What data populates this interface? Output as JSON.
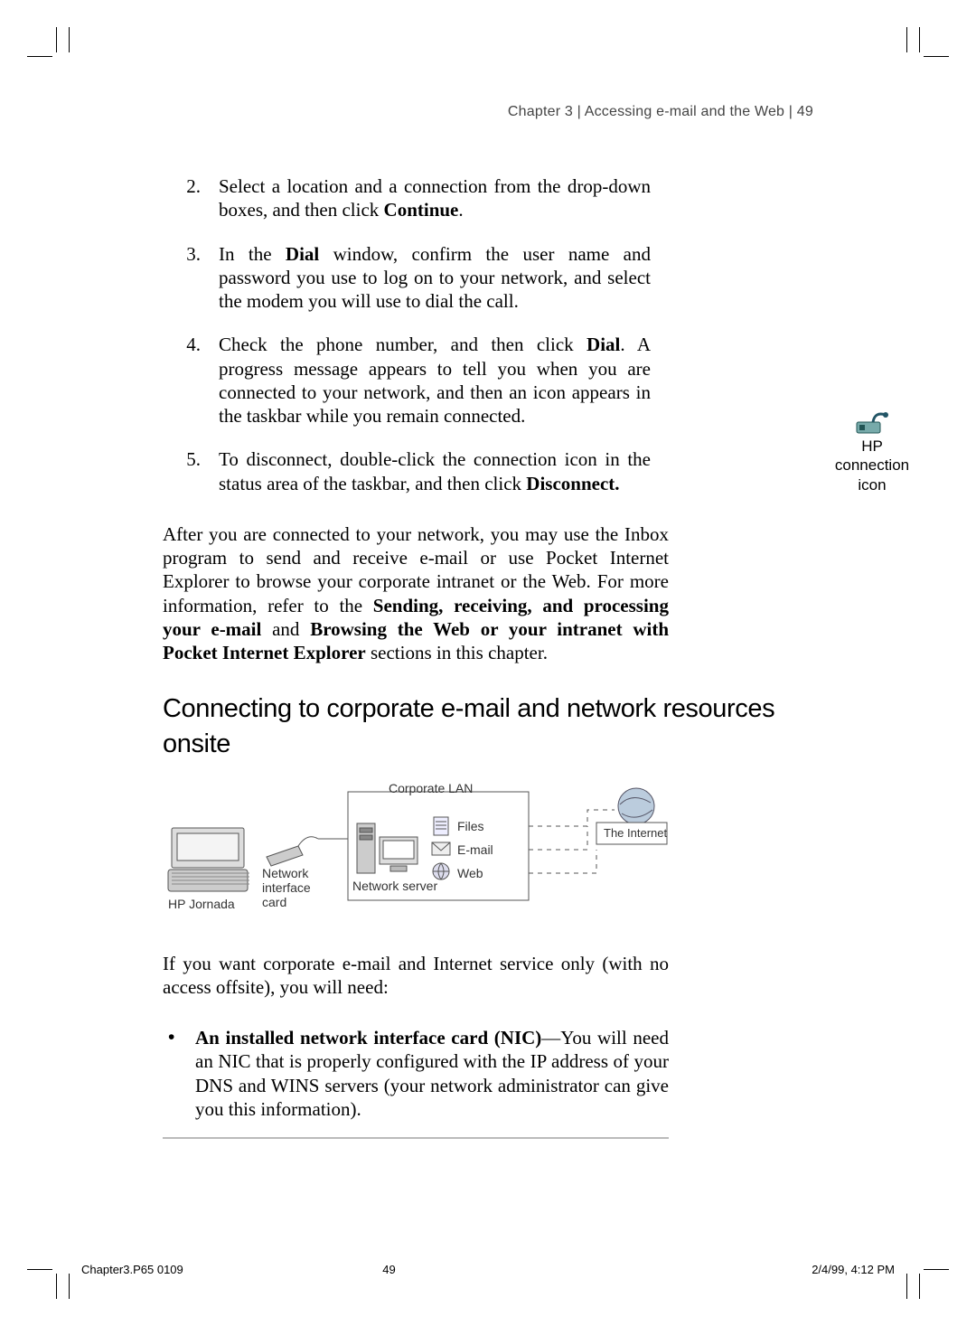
{
  "header": {
    "running_head": "Chapter 3 | Accessing e-mail and the Web | 49"
  },
  "steps": [
    {
      "num": "2.",
      "pre": "Select a location and a connection from the drop-down boxes, and then click ",
      "b1": "Continue",
      "post": "."
    },
    {
      "num": "3.",
      "pre": "In the ",
      "b1": "Dial",
      "mid": " window, confirm the user name and password you use to log on to your network, and select the modem you will use to dial the call.",
      "post": ""
    },
    {
      "num": "4.",
      "pre": "Check the phone number, and then click ",
      "b1": "Dial",
      "mid": ". A progress message appears to tell you when you are connected to your network, and then an icon appears in the taskbar while you remain connected.",
      "post": ""
    },
    {
      "num": "5.",
      "pre": "To disconnect, double-click the connection icon in the status area of the taskbar, and then click ",
      "b1": "Disconnect.",
      "post": ""
    }
  ],
  "para1": {
    "pre": "After you are connected to your network, you may use the Inbox program to send and receive e-mail or use Pocket Internet Explorer to browse your corporate intranet or the Web. For more information, refer to the ",
    "b1": "Sending, receiving, and processing your e-mail",
    "mid": " and ",
    "b2": "Browsing the Web or your intranet with Pocket Internet Explorer",
    "post": " sections in this chapter."
  },
  "heading": "Connecting to corporate e-mail and network resources onsite",
  "diagram": {
    "corporate_lan": "Corporate LAN",
    "files": "Files",
    "email": "E-mail",
    "web": "Web",
    "network_server": "Network server",
    "internet": "The Internet",
    "nic": "Network\ninterface\ncard",
    "hp_jornada": "HP Jornada"
  },
  "para2": "If you want corporate e-mail and Internet service only (with no access offsite), you will need:",
  "bullet1": {
    "b1": "An installed network interface card (NIC)",
    "post": "—You will need an NIC that is properly configured with the IP address of your DNS and WINS servers (your network administrator can give you this information)."
  },
  "side_icon": {
    "label": "HP connection icon"
  },
  "footer": {
    "left": "Chapter3.P65 0109",
    "center": "49",
    "right": "2/4/99, 4:12 PM"
  }
}
